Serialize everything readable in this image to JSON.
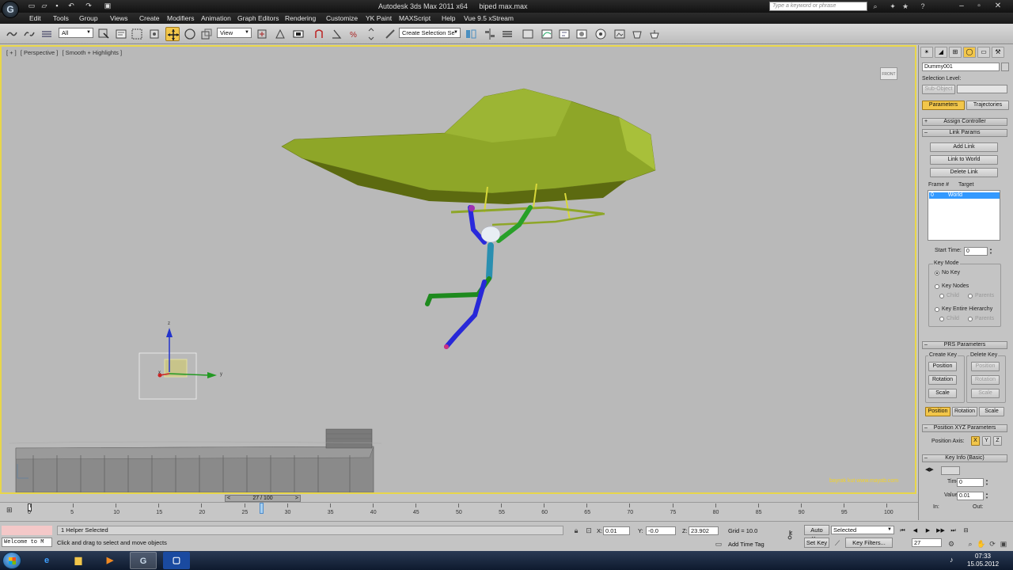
{
  "titlebar": {
    "app_title": "Autodesk 3ds Max  2011 x64",
    "file_name": "biped max.max",
    "search_placeholder": "Type a keyword or phrase",
    "logo": "3ds-max-logo"
  },
  "menu": [
    "Edit",
    "Tools",
    "Group",
    "Views",
    "Create",
    "Modifiers",
    "Animation",
    "Graph Editors",
    "Rendering",
    "Customize",
    "YK Paint",
    "MAXScript",
    "Help",
    "Vue 9.5 xStream"
  ],
  "toolbar": {
    "selection_filter": "All",
    "reference_coord": "View",
    "named_selection": "Create Selection Se"
  },
  "viewport": {
    "label_parts": [
      "[ + ]",
      "[ Perspective ]",
      "[ Smooth + Highlights ]"
    ],
    "viewcube_label": "FRONT",
    "watermark": "bayrak kut www.mayab.com",
    "axis_labels": {
      "x": "x",
      "y": "y",
      "z": "z"
    }
  },
  "command_panel": {
    "object_name": "Dummy001",
    "selection_level_label": "Selection Level:",
    "sub_object_label": "Sub-Object",
    "tabs": [
      "Parameters",
      "Trajectories"
    ],
    "rollouts": {
      "assign_controller": "Assign Controller",
      "link_params": "Link Params",
      "prs_parameters": "PRS Parameters",
      "position_xyz": "Position XYZ Parameters",
      "key_info": "Key Info (Basic)"
    },
    "link_buttons": [
      "Add Link",
      "Link to World",
      "Delete Link"
    ],
    "list_headers": {
      "frame": "Frame #",
      "target": "Target"
    },
    "list_row": {
      "frame": "0",
      "target": "World"
    },
    "start_time_label": "Start Time:",
    "start_time_value": "0",
    "key_mode_label": "Key Mode",
    "key_modes": [
      "No Key",
      "Key Nodes",
      "Key Entire Hierarchy"
    ],
    "child_parents": [
      "Child",
      "Parents"
    ],
    "create_key_label": "Create Key",
    "delete_key_label": "Delete Key",
    "prs_buttons": [
      "Position",
      "Rotation",
      "Scale"
    ],
    "prs_tabs": [
      "Position",
      "Rotation",
      "Scale"
    ],
    "position_axis_label": "Position Axis:",
    "axes": [
      "X",
      "Y",
      "Z"
    ],
    "time_label": "Time:",
    "time_value": "0",
    "value_label": "Value:",
    "value_value": "0.01",
    "in_label": "In:",
    "out_label": "Out:"
  },
  "timeline": {
    "slider_label": "27 / 100",
    "ticks": [
      "0",
      "5",
      "10",
      "15",
      "20",
      "25",
      "30",
      "35",
      "40",
      "45",
      "50",
      "55",
      "60",
      "65",
      "70",
      "75",
      "80",
      "85",
      "90",
      "95",
      "100"
    ],
    "current_frame": 27
  },
  "status": {
    "listener_text": "Welcome to M",
    "selection_count": "1 Helper Selected",
    "prompt": "Click and drag to select and move objects",
    "x_label": "X:",
    "x_value": "0.01",
    "y_label": "Y:",
    "y_value": "-0.0",
    "z_label": "Z:",
    "z_value": "23.902",
    "grid": "Grid = 10.0",
    "add_time_tag": "Add Time Tag",
    "auto_key": "Auto Key",
    "set_key": "Set Key",
    "key_selected": "Selected",
    "key_filters": "Key Filters...",
    "frame_field": "27"
  },
  "taskbar": {
    "time": "07:33",
    "date": "15.05.2012"
  },
  "colors": {
    "viewport_border": "#e8d64a",
    "active_yellow": "#f2c64a",
    "helicopter": "#8ea628",
    "selection_blue": "#3399ff"
  }
}
